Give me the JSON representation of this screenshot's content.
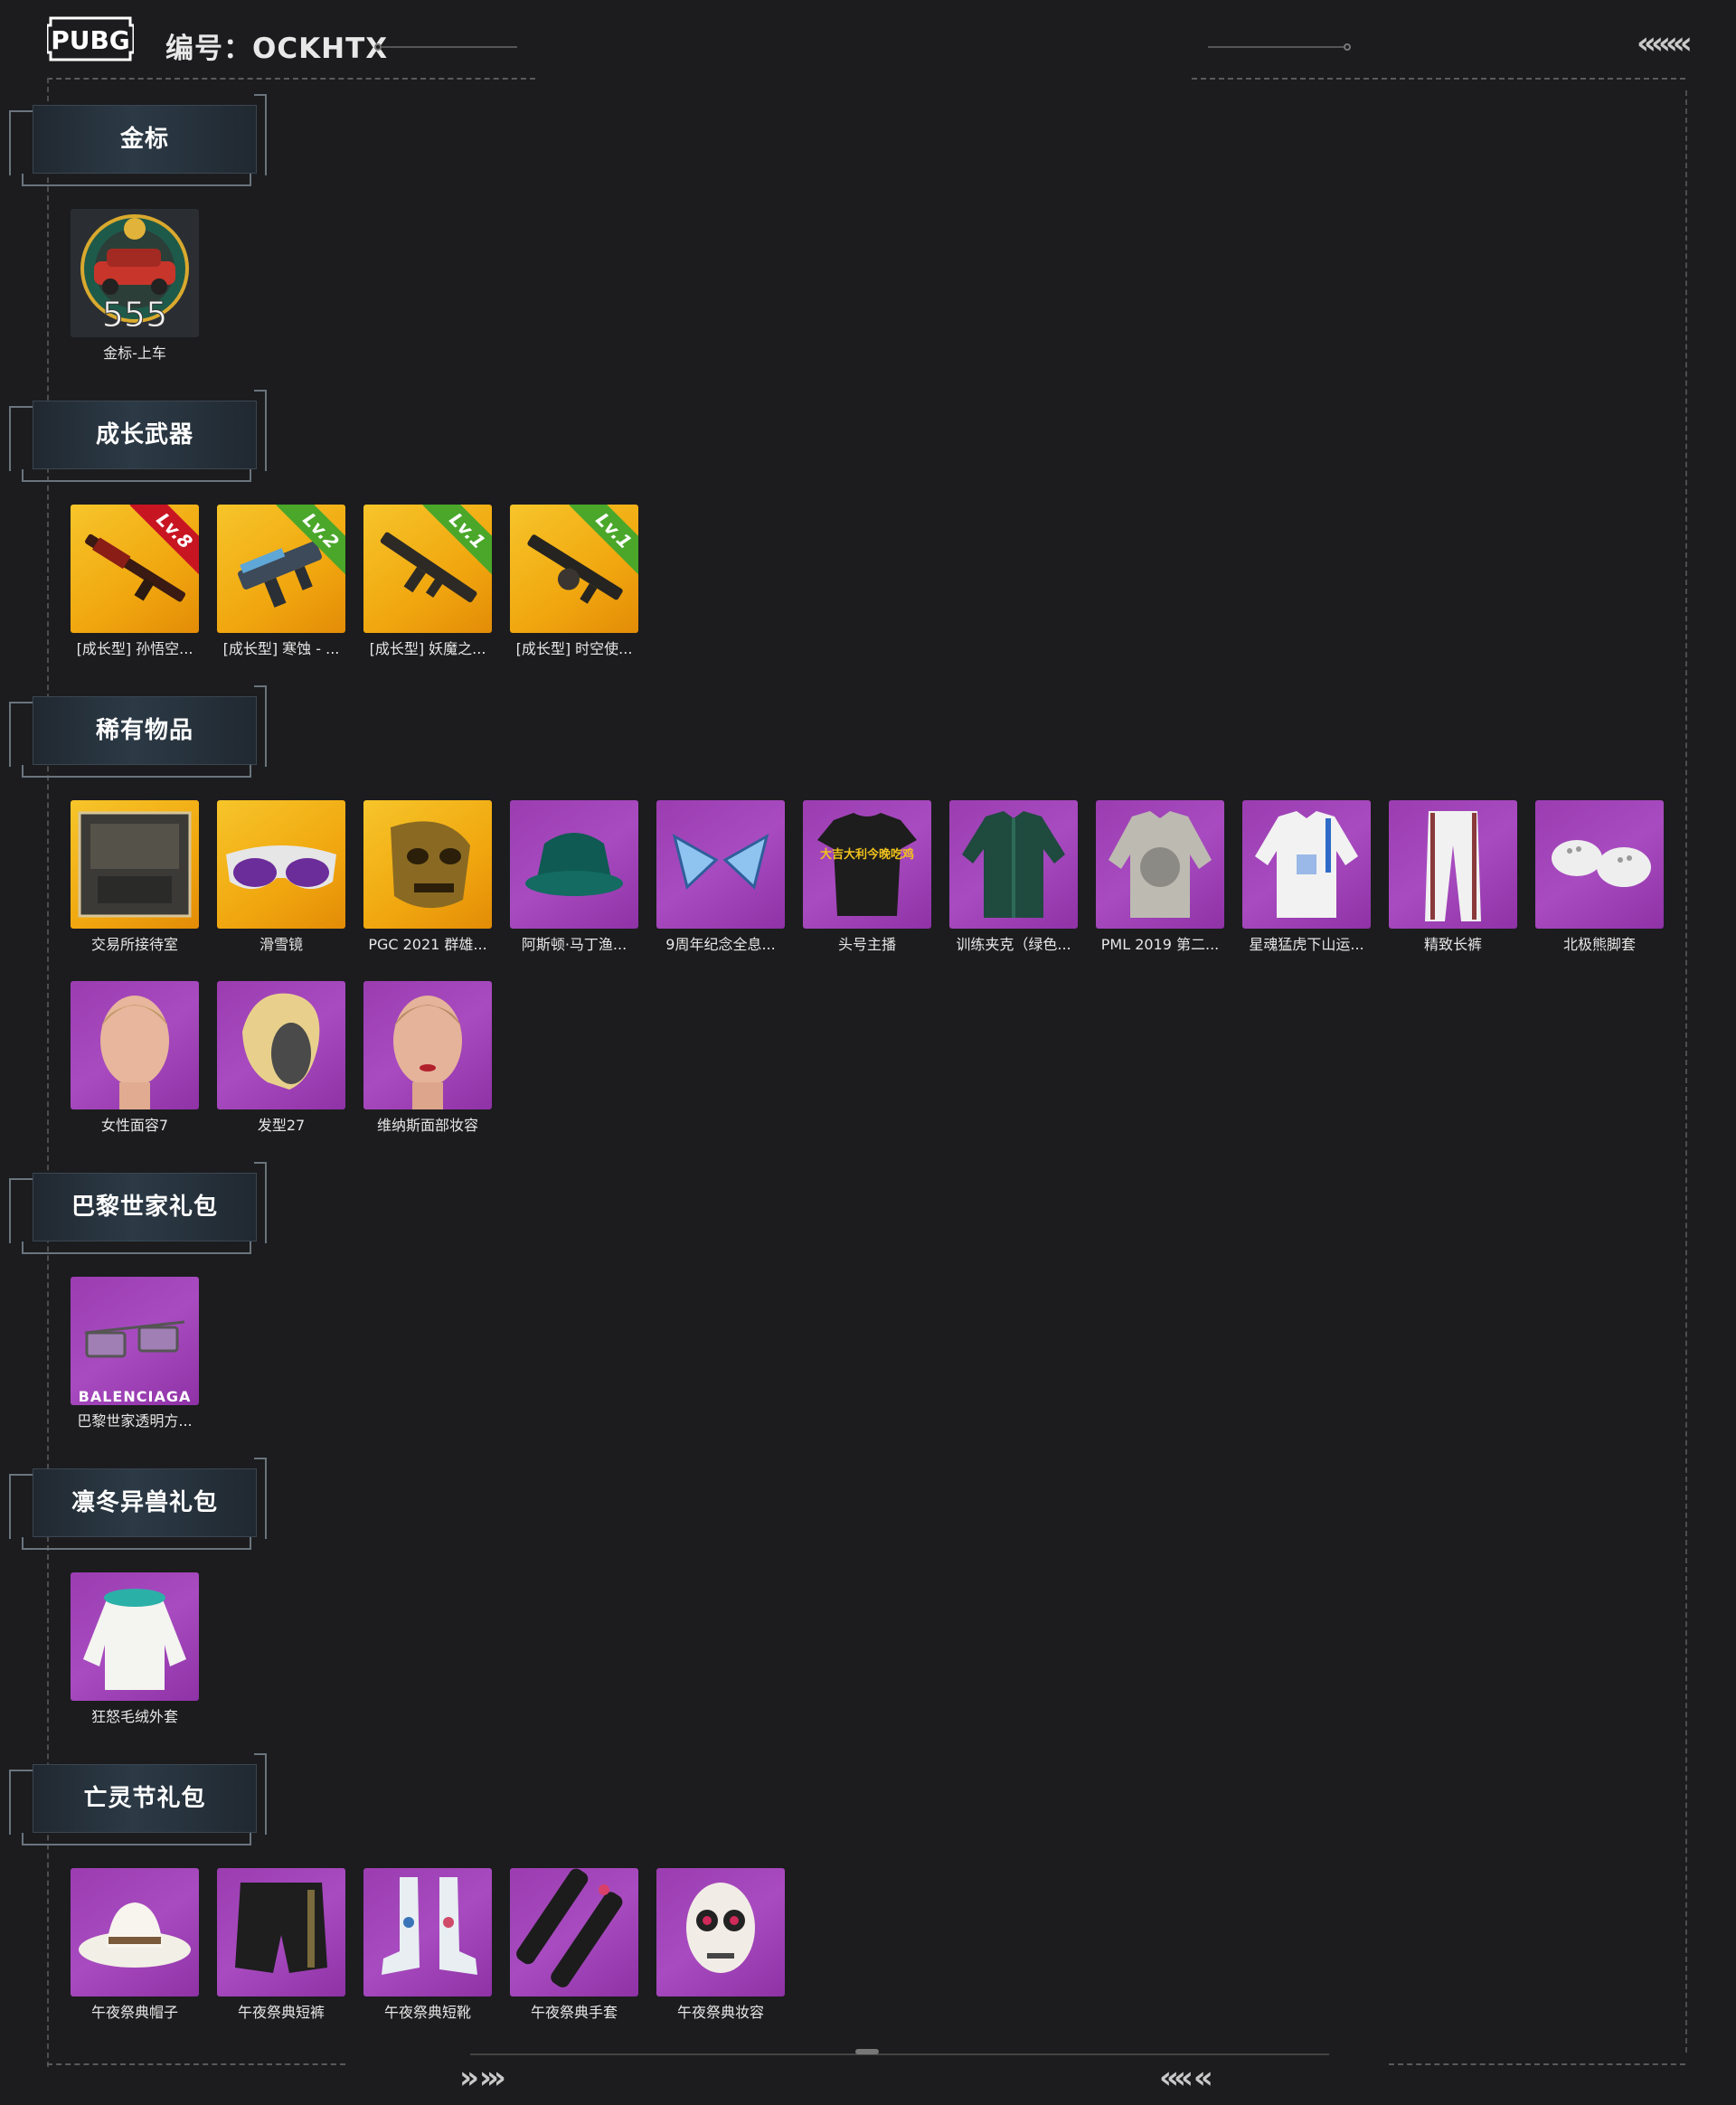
{
  "header": {
    "logo_text": "PUBG",
    "code_label": "编号：OCKHTX"
  },
  "sections": [
    {
      "title": "金标",
      "items": [
        {
          "name": "金标-上车",
          "overlay": "555"
        }
      ]
    },
    {
      "title": "成长武器",
      "items": [
        {
          "name": "[成长型] 孙悟空...",
          "level": "Lv.8"
        },
        {
          "name": "[成长型] 寒蚀 - ...",
          "level": "Lv.2"
        },
        {
          "name": "[成长型] 妖魔之...",
          "level": "Lv.1"
        },
        {
          "name": "[成长型] 时空使...",
          "level": "Lv.1"
        }
      ]
    },
    {
      "title": "稀有物品",
      "items": [
        {
          "name": "交易所接待室"
        },
        {
          "name": "滑雪镜"
        },
        {
          "name": "PGC 2021 群雄..."
        },
        {
          "name": "阿斯顿·马丁渔..."
        },
        {
          "name": "9周年纪念全息..."
        },
        {
          "name": "头号主播",
          "overlay": "大吉大利今晚吃鸡"
        },
        {
          "name": "训练夹克（绿色..."
        },
        {
          "name": "PML 2019 第二..."
        },
        {
          "name": "星魂猛虎下山运..."
        },
        {
          "name": "精致长裤"
        },
        {
          "name": "北极熊脚套"
        },
        {
          "name": "女性面容7"
        },
        {
          "name": "发型27"
        },
        {
          "name": "维纳斯面部妆容"
        }
      ]
    },
    {
      "title": "巴黎世家礼包",
      "items": [
        {
          "name": "巴黎世家透明方...",
          "overlay": "BALENCIAGA"
        }
      ]
    },
    {
      "title": "凛冬异兽礼包",
      "items": [
        {
          "name": "狂怒毛绒外套"
        }
      ]
    },
    {
      "title": "亡灵节礼包",
      "items": [
        {
          "name": "午夜祭典帽子"
        },
        {
          "name": "午夜祭典短裤"
        },
        {
          "name": "午夜祭典短靴"
        },
        {
          "name": "午夜祭典手套"
        },
        {
          "name": "午夜祭典妆容"
        }
      ]
    }
  ],
  "icons": [
    "pubg-logo-icon",
    "chevrons-left-icon",
    "chevrons-right-icon"
  ],
  "colors": {
    "background": "#1c1c1e",
    "rare_purple": "#a84bc0",
    "legend_gold": "#f1a70f",
    "level_red": "#c81522",
    "level_green": "#4aa72a"
  }
}
